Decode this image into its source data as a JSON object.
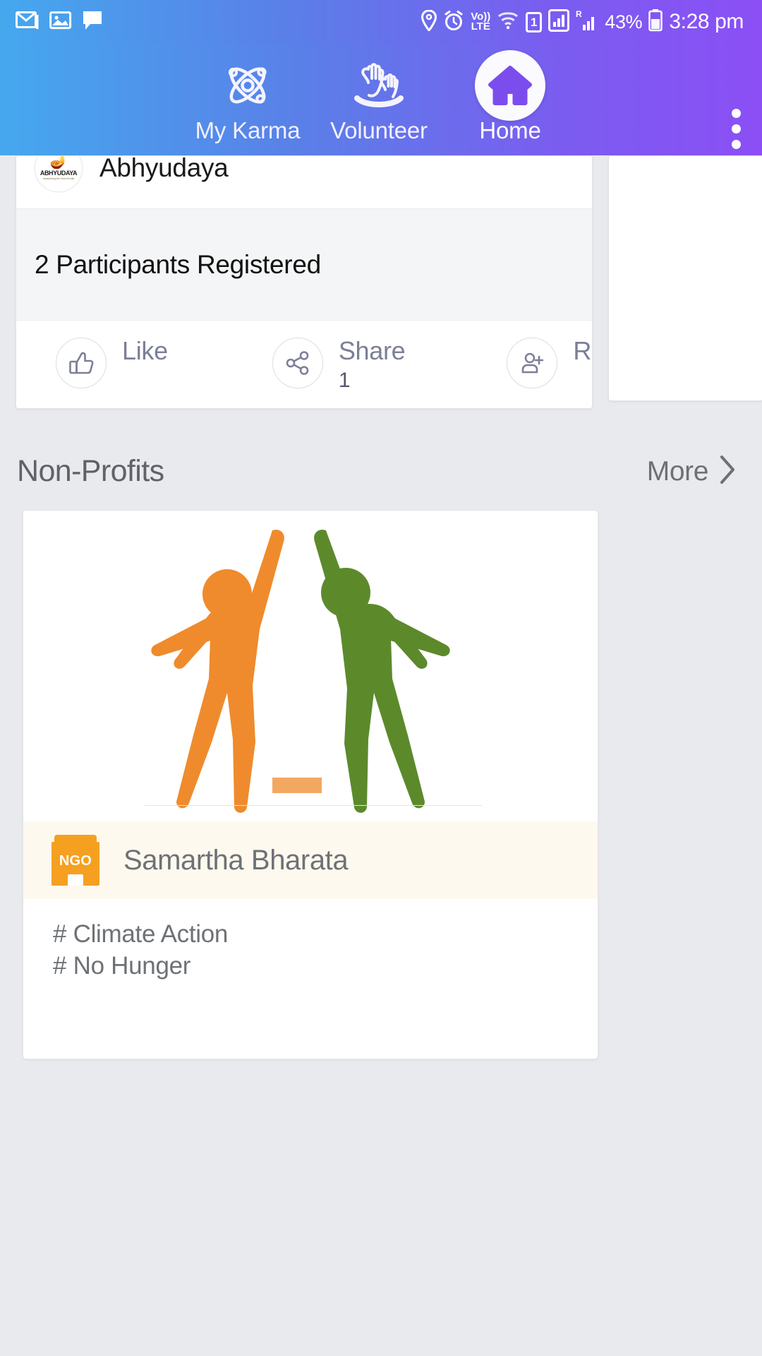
{
  "status_bar": {
    "left_icons": [
      "gmail-icon",
      "gallery-icon",
      "message-icon"
    ],
    "right_icons": [
      "location-icon",
      "alarm-icon",
      "volte-icon",
      "wifi-icon",
      "sim-icon",
      "signal-icon",
      "roaming-signal-icon"
    ],
    "volte_top": "Vo))",
    "volte_bottom": "LTE",
    "sim_label": "1",
    "battery_percent": "43%",
    "time": "3:28 pm"
  },
  "header": {
    "nav": [
      {
        "label": "My Karma",
        "icon": "atom-icon",
        "active": false
      },
      {
        "label": "Volunteer",
        "icon": "raised-hands-icon",
        "active": false
      },
      {
        "label": "Home",
        "icon": "home-icon",
        "active": true
      }
    ],
    "overflow_icon": "kebab-menu-icon",
    "gradient_start": "#45a8ee",
    "gradient_end": "#8b4ff5"
  },
  "event_card": {
    "organization": "Abhyudaya",
    "logo_text": "ABHYUDAYA",
    "logo_tagline": "Awakening the Soul of India",
    "participants": "2 Participants Registered",
    "actions": [
      {
        "label": "Like",
        "icon": "thumbs-up-icon",
        "count": ""
      },
      {
        "label": "Share",
        "icon": "share-icon",
        "count": "1"
      },
      {
        "label": "Register",
        "icon": "person-add-icon",
        "count": ""
      }
    ]
  },
  "non_profits": {
    "section_title": "Non-Profits",
    "more_label": "More",
    "more_icon": "chevron-right-icon",
    "cards": [
      {
        "badge_text": "NGO",
        "badge_icon": "ngo-building-icon",
        "name": "Samartha Bharata",
        "logo_alt": "two-people-raising-hands-logo",
        "logo_colors": {
          "orange": "#ef8b2c",
          "green": "#5c8a2b"
        },
        "tags": [
          "# Climate Action",
          "# No Hunger"
        ]
      }
    ]
  },
  "colors": {
    "page_background": "#e9eaee",
    "card_background": "#ffffff",
    "name_bar_background": "#fdf9ef",
    "muted_text": "#6e7175",
    "accent_orange": "#f5a020"
  }
}
